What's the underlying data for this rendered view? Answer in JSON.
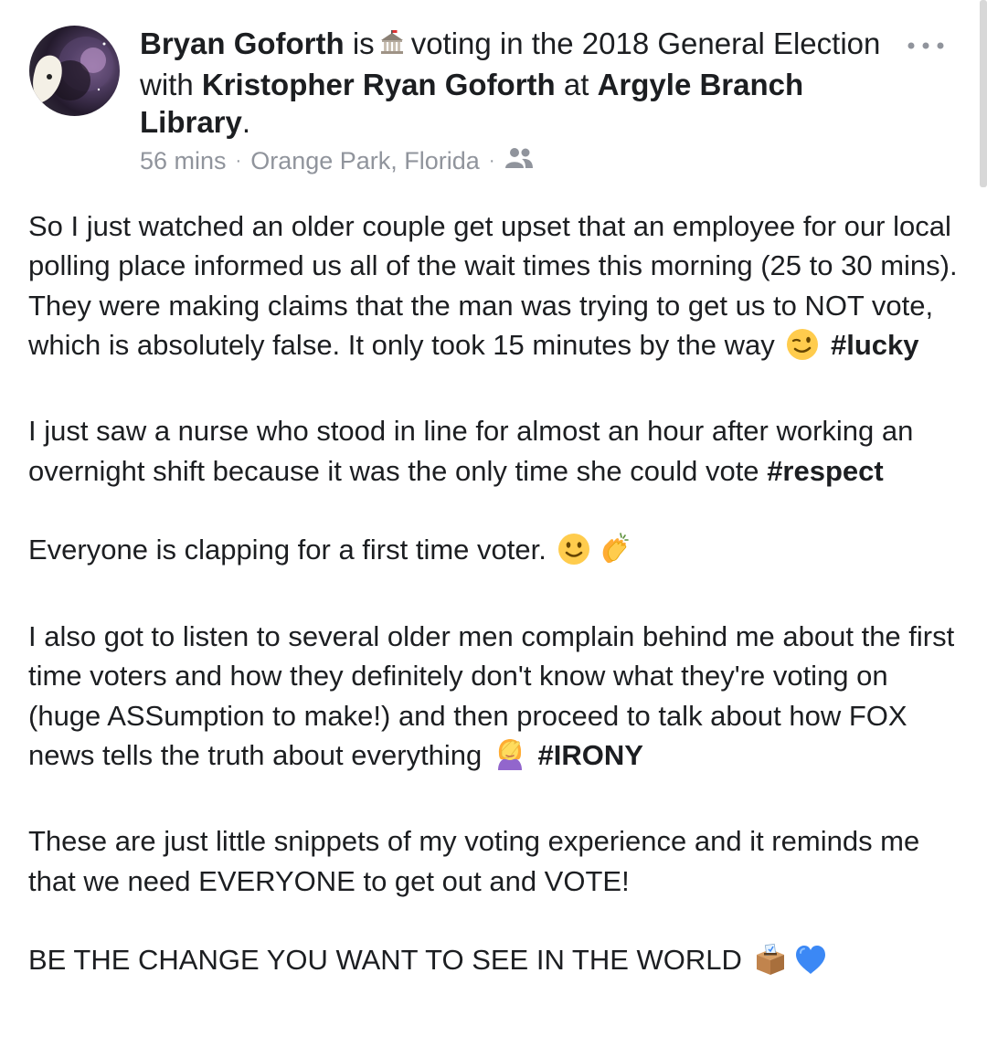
{
  "post": {
    "author": "Bryan Goforth",
    "is": "is",
    "activity": "voting in the 2018 General Election",
    "with": "with",
    "tagged": "Kristopher Ryan Goforth",
    "at": "at",
    "place": "Argyle Branch Library",
    "period": ".",
    "time": "56 mins",
    "location": "Orange Park, Florida",
    "separator": "·",
    "audience_icon": "friends-icon",
    "activity_icon": "government-building-icon",
    "more_icon": "more-options-icon"
  },
  "body": {
    "p1": {
      "text": "So I just watched an older couple get upset that an employee for our local polling place informed us all of the wait times this morning (25 to 30 mins). They were making claims that the man was trying to get us to NOT vote, which is absolutely false. It only took 15 minutes by the way",
      "emoji": "winking-face-emoji",
      "hashtag": "#lucky"
    },
    "p2": {
      "text": "I just saw a nurse who stood in line for almost an hour after working an overnight shift because it was the only time she could vote",
      "hashtag": "#respect"
    },
    "p3": {
      "text": "Everyone is clapping for a first time voter.",
      "emojis": [
        "smiling-face-emoji",
        "clapping-hands-emoji"
      ]
    },
    "p4": {
      "text": "I also got to listen to several older men complain behind me about the first time voters and how they definitely don't know what they're voting on (huge ASSumption to make!) and then proceed to talk about how FOX news tells the truth about everything",
      "emoji": "woman-facepalming-emoji",
      "hashtag": "#IRONY"
    },
    "p5": {
      "text": "These are just little snippets of my voting experience and it reminds me that we need EVERYONE to get out and VOTE!"
    },
    "p6": {
      "text": "BE THE CHANGE YOU WANT TO SEE IN THE WORLD",
      "emojis": [
        "ballot-box-emoji",
        "blue-heart-emoji"
      ]
    }
  },
  "colors": {
    "text": "#1c1e21",
    "meta": "#90949c",
    "heart": "#3b88f5"
  }
}
